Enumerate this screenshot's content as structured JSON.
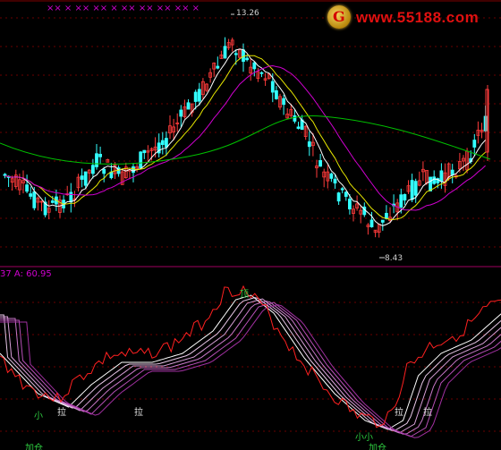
{
  "logo": {
    "glyph": "G",
    "text": "www.55188.com"
  },
  "markers": "×× × ×× ×× × ×× ×× ×× ×× ×",
  "price_high": "13.26",
  "price_low": "8.43",
  "indicator_readout": "37 A: 60.95",
  "annotations": {
    "top_marker": "顶",
    "small1": "小",
    "small2": "小小",
    "la1": "拉",
    "la2": "拉",
    "la3": "拉",
    "la4": "拉",
    "buy1": "加仓",
    "buy2": "加仓"
  },
  "colors": {
    "up": "#ff3b3b",
    "down": "#33ffff",
    "ma_white": "#ffffff",
    "ma_yellow": "#e6e600",
    "ma_magenta": "#d000d0",
    "ma_green": "#00c000",
    "osc_red": "#ff2020",
    "osc_pink": "#d040d0",
    "divider": "#a00060"
  }
}
